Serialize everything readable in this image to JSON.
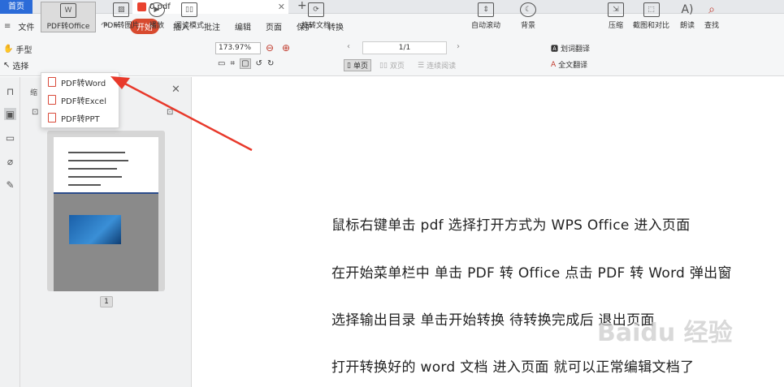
{
  "tabs": {
    "home": "首页",
    "docer": "稻壳",
    "file": "0.pdf"
  },
  "menubar": {
    "file": "文件",
    "start": "开始",
    "items": [
      "插入",
      "批注",
      "编辑",
      "页面",
      "保护",
      "转换"
    ]
  },
  "toolbar": {
    "hand": "手型",
    "select": "选择",
    "pdf_to_office": "PDF转Office",
    "pdf_to_image": "PDF转图片",
    "play": "播放",
    "read_mode": "阅读模式",
    "zoom": "173.97%",
    "rotate": "旋转文档",
    "page_value": "1/1",
    "single_page": "单页",
    "double_page": "双页",
    "continuous": "连续阅读",
    "auto_scroll": "自动滚动",
    "background": "背景",
    "word_translate": "划词翻译",
    "full_translate": "全文翻译",
    "compress": "压缩",
    "screenshot_compare": "截图和对比",
    "read_aloud": "朗读",
    "find": "查找"
  },
  "dropdown": {
    "items": [
      "PDF转Word",
      "PDF转Excel",
      "PDF转PPT"
    ]
  },
  "panel": {
    "title": "缩",
    "page_number": "1"
  },
  "document": {
    "lines": [
      "鼠标右键单击 pdf   选择打开方式为 WPS Office   进入页面",
      "在开始菜单栏中   单击 PDF 转 Office   点击 PDF 转 Word   弹出窗",
      "选择输出目录   单击开始转换   待转换完成后   退出页面",
      "打开转换好的 word 文档   进入页面   就可以正常编辑文档了"
    ]
  },
  "watermark": "Baidu 经验",
  "colors": {
    "accent": "#2b6bd8",
    "start": "#d84a2f",
    "arrow": "#e8392b"
  }
}
